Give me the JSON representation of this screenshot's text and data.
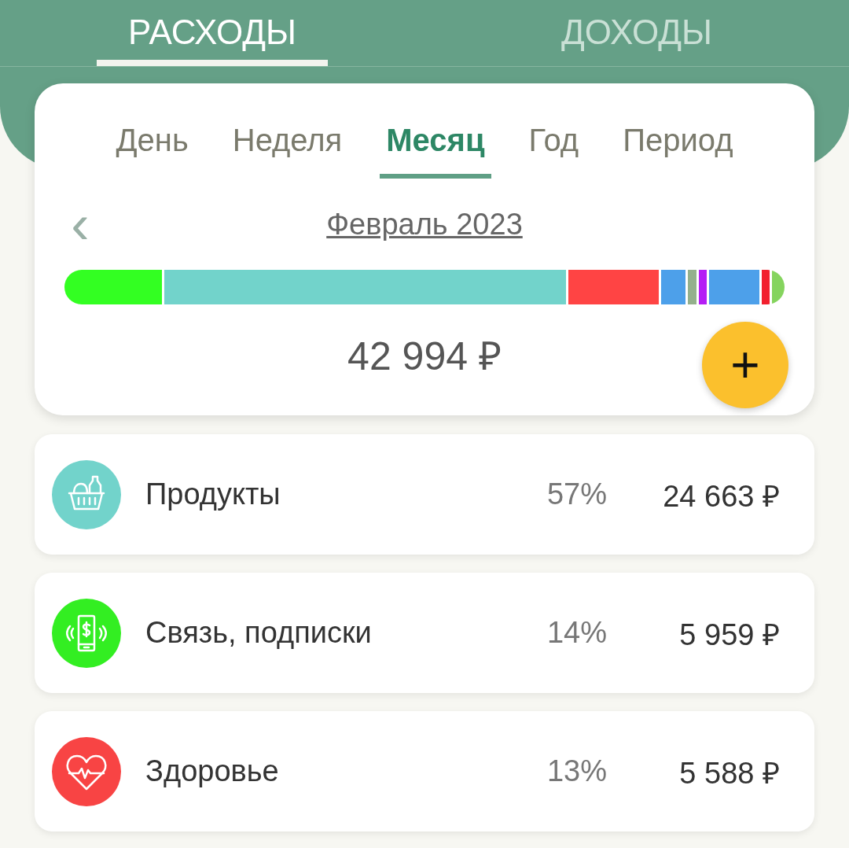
{
  "top_tabs": [
    {
      "label": "РАСХОДЫ",
      "selected": true
    },
    {
      "label": "ДОХОДЫ",
      "selected": false
    }
  ],
  "period_tabs": [
    {
      "label": "День",
      "selected": false
    },
    {
      "label": "Неделя",
      "selected": false
    },
    {
      "label": "Месяц",
      "selected": true
    },
    {
      "label": "Год",
      "selected": false
    },
    {
      "label": "Период",
      "selected": false
    }
  ],
  "month": {
    "back": "‹",
    "label": "Февраль 2023"
  },
  "breakdown_bar": [
    {
      "color": "#33ff22"
    },
    {
      "color": "#72d3cb"
    },
    {
      "color": "#ff4444"
    },
    {
      "color": "#4da0ea"
    },
    {
      "color": "#94b08c"
    },
    {
      "color": "#b51ef5"
    },
    {
      "color": "#4da0ea"
    },
    {
      "color": "#f2202e"
    },
    {
      "color": "#85d45e"
    }
  ],
  "total": "42 994 ₽",
  "add_button": "+",
  "categories": [
    {
      "kind": "groceries",
      "color": "#72d3cb",
      "name": "Продукты",
      "percent": "57%",
      "amount": "24 663 ₽"
    },
    {
      "kind": "phone",
      "color": "#33ee22",
      "name": "Связь, подписки",
      "percent": "14%",
      "amount": "5 959 ₽"
    },
    {
      "kind": "health",
      "color": "#f84444",
      "name": "Здоровье",
      "percent": "13%",
      "amount": "5 588 ₽"
    }
  ]
}
